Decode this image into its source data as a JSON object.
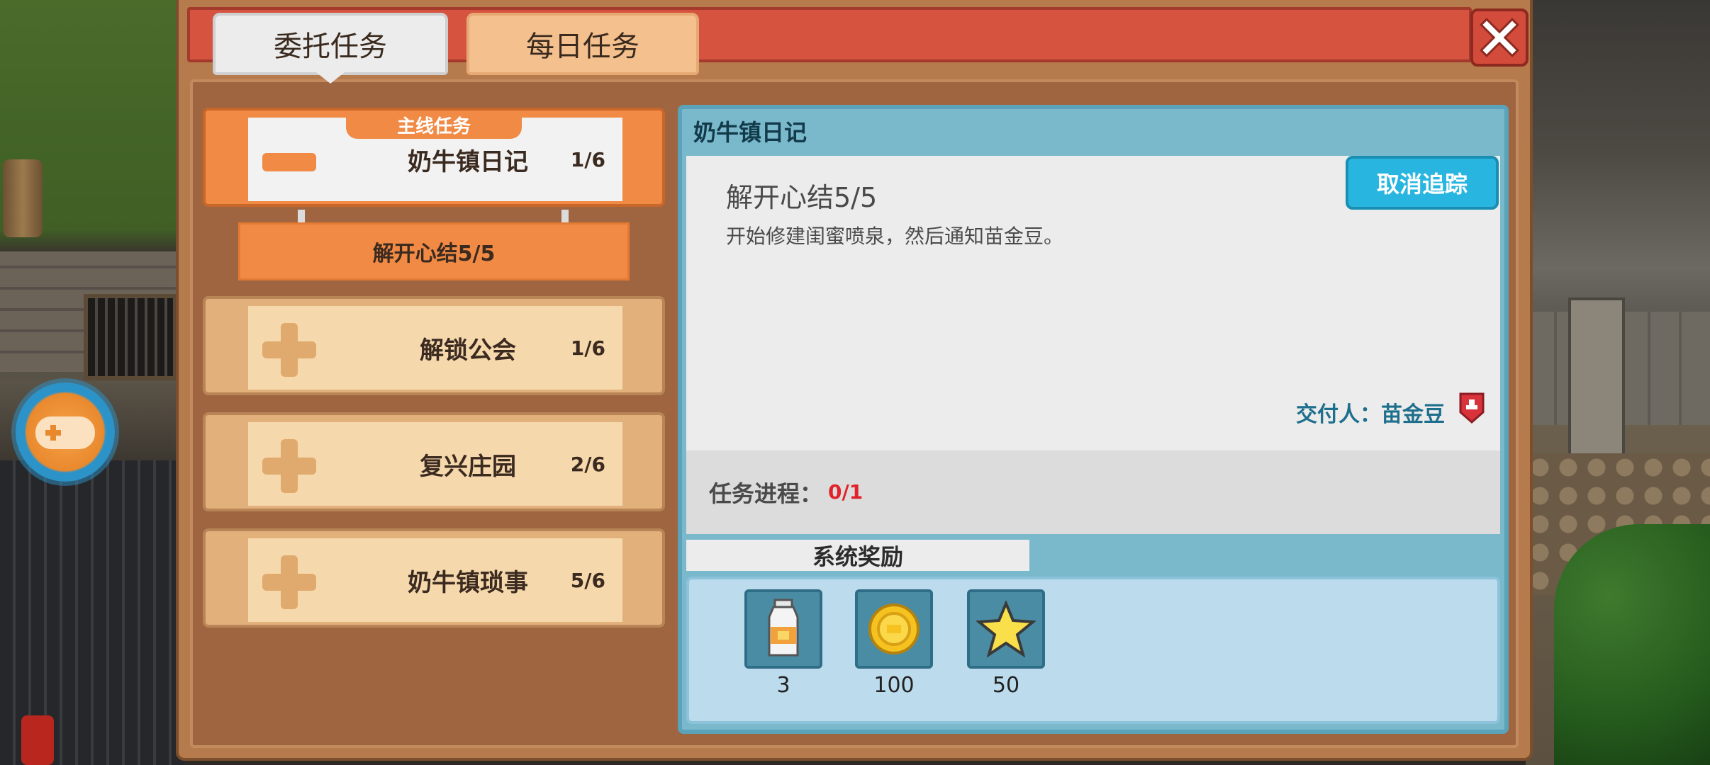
{
  "tabs": [
    {
      "label": "委托任务",
      "active": true
    },
    {
      "label": "每日任务",
      "active": false
    }
  ],
  "main_tag": "主线任务",
  "quests": [
    {
      "name": "奶牛镇日记",
      "count": "1/6",
      "expanded": true
    },
    {
      "name": "解锁公会",
      "count": "1/6",
      "expanded": false
    },
    {
      "name": "复兴庄园",
      "count": "2/6",
      "expanded": false
    },
    {
      "name": "奶牛镇琐事",
      "count": "5/6",
      "expanded": false
    }
  ],
  "sub_task": "解开心结5/5",
  "detail": {
    "title": "奶牛镇日记",
    "objective_title": "解开心结5/5",
    "objective_desc": "开始修建闺蜜喷泉，然后通知苗金豆。",
    "cancel_label": "取消追踪",
    "giver": "交付人：苗金豆",
    "progress_label": "任务进程：",
    "progress_value": "0/1",
    "reward_tab": "系统奖励",
    "rewards": [
      {
        "icon": "milk-bottle-icon",
        "qty": "3"
      },
      {
        "icon": "gold-coin-icon",
        "qty": "100"
      },
      {
        "icon": "star-icon",
        "qty": "50"
      }
    ]
  },
  "colors": {
    "header": "#d5533f",
    "active_quest": "#f18a44",
    "cancel_button": "#28b6e0",
    "progress_value": "#e0222a"
  }
}
